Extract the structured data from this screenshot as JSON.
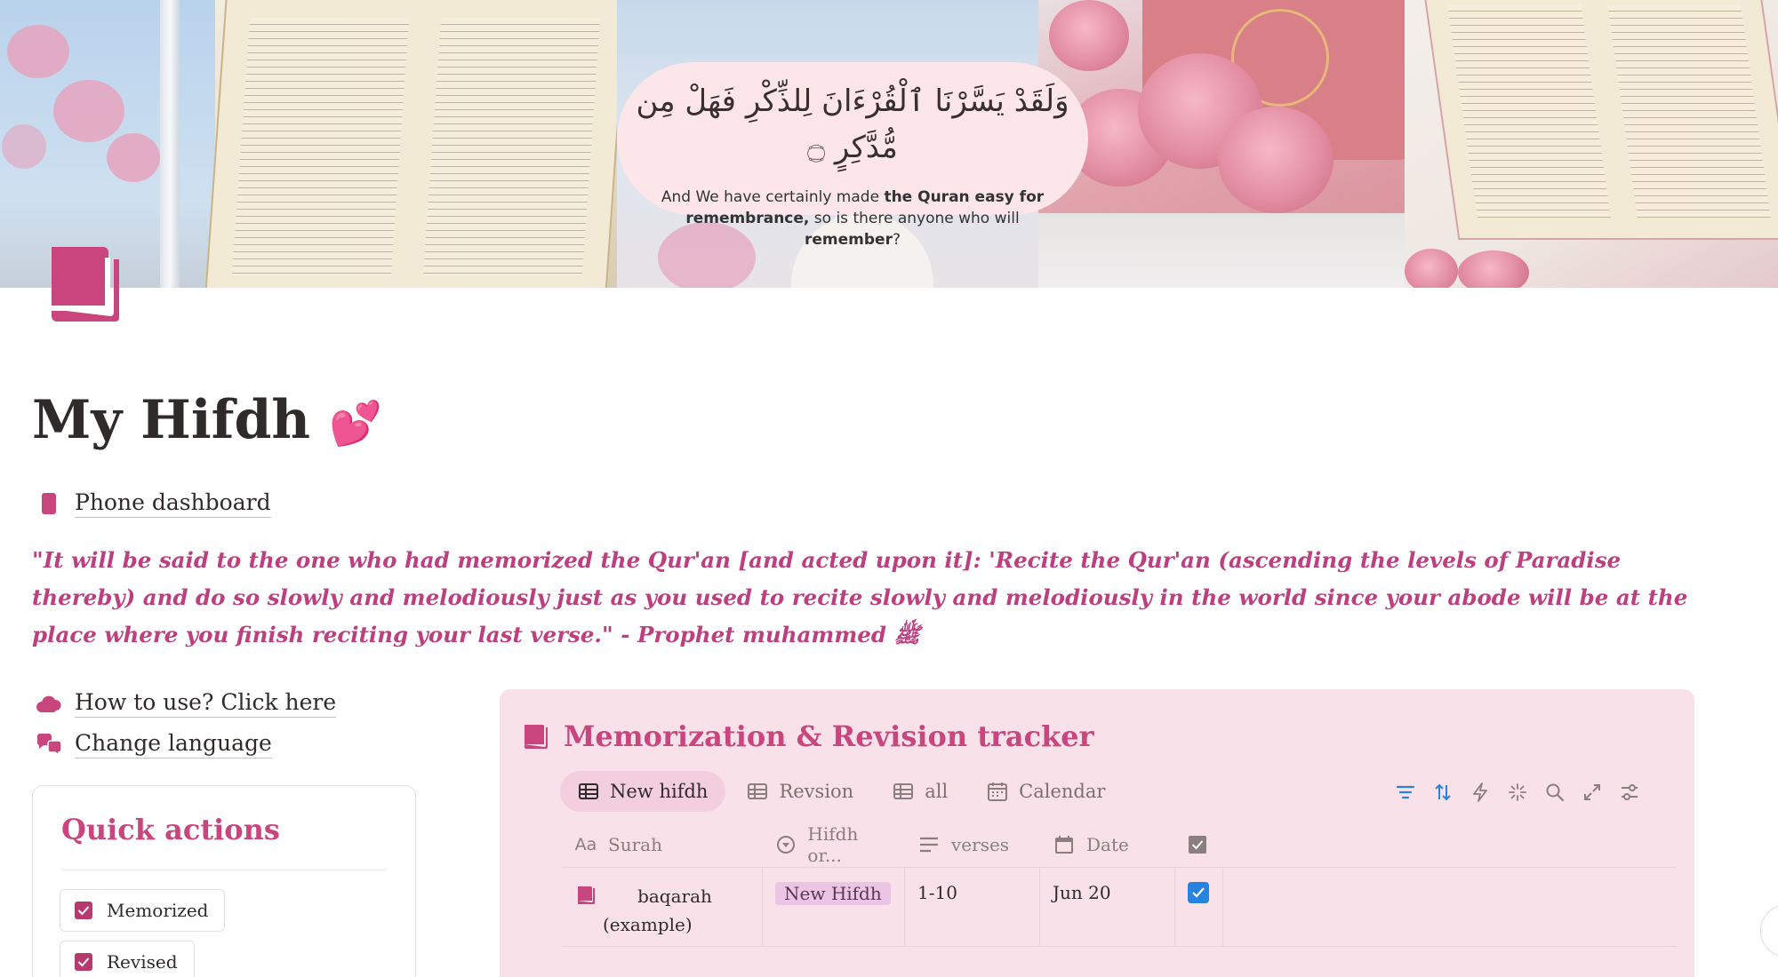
{
  "cover": {
    "verse_arabic": "وَلَقَدْ يَسَّرْنَا ٱلْقُرْءَانَ لِلذِّكْرِ فَهَلْ مِن مُّدَّكِرٍ ۝",
    "verse_english_1": "And We have certainly made ",
    "verse_english_b1": "the Quran easy for remembrance,",
    "verse_english_2": " so is there anyone who will ",
    "verse_english_b2": "remember",
    "verse_english_3": "?"
  },
  "page": {
    "title": "My Hifdh",
    "title_emoji": "💕",
    "phone_dashboard": "Phone dashboard",
    "quote": "\"It will be said to the one who had memorized the Qur'an [and acted upon it]: 'Recite the Qur'an (ascending the levels of Paradise thereby) and do so slowly and melodiously just as you used to recite slowly and melodiously in the world since your abode will be at the place where you finish reciting your last verse.\" - Prophet muhammed ﷺ",
    "how_to_use": "How to use? Click here",
    "change_language": "Change language"
  },
  "quick_actions": {
    "title": "Quick actions",
    "buttons": [
      {
        "label": "Memorized"
      },
      {
        "label": "Revised"
      }
    ]
  },
  "tracker": {
    "title": "Memorization & Revision tracker",
    "tabs": [
      {
        "label": "New hifdh",
        "icon": "table-icon"
      },
      {
        "label": "Revsion",
        "icon": "table-icon"
      },
      {
        "label": "all",
        "icon": "table-icon"
      },
      {
        "label": "Calendar",
        "icon": "calendar-icon"
      }
    ],
    "columns": [
      "Surah",
      "Hifdh or...",
      "verses",
      "Date",
      ""
    ],
    "rows": [
      {
        "surah_1": "baqarah",
        "surah_2": "(example)",
        "type": "New Hifdh",
        "verses": "1-10",
        "date": "Jun 20",
        "checked": true
      }
    ]
  },
  "colors": {
    "accent": "#c9457e",
    "tracker_bg": "#f9e1ea",
    "checkbox_blue": "#2783de"
  }
}
